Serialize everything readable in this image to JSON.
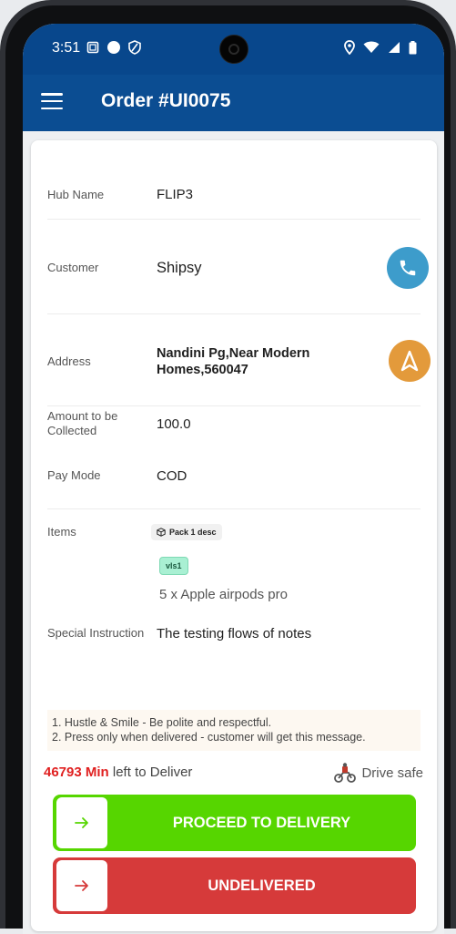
{
  "status_bar": {
    "time": "3:51"
  },
  "app_bar": {
    "title": "Order #UI0075"
  },
  "order": {
    "hub": {
      "label": "Hub Name",
      "value": "FLIP3"
    },
    "customer": {
      "label": "Customer",
      "value": "Shipsy"
    },
    "address": {
      "label": "Address",
      "value_line1": "Nandini Pg,Near Modern",
      "value_line2": "Homes,560047"
    },
    "amount": {
      "label_line1": "Amount to be",
      "label_line2": "Collected",
      "value": "100.0"
    },
    "pay_mode": {
      "label": "Pay Mode",
      "value": "COD"
    },
    "items": {
      "label": "Items",
      "pack_chip": "Pack 1 desc",
      "tag": "vls1",
      "item_text": "5 x Apple airpods pro"
    },
    "special_instruction": {
      "label": "Special Instruction",
      "value": "The testing flows of notes"
    }
  },
  "notes": {
    "line1": "1. Hustle & Smile - Be polite and respectful.",
    "line2": "2. Press only when delivered - customer will get this message."
  },
  "timer": {
    "minutes": "46793 Min",
    "suffix": " left to Deliver",
    "drive_safe": "Drive safe"
  },
  "actions": {
    "proceed_label": "PROCEED TO DELIVERY",
    "undelivered_label": "UNDELIVERED"
  },
  "colors": {
    "primary": "#0b4d92",
    "call_button": "#3d9ccb",
    "navigate_button": "#e39a3b",
    "proceed": "#56d600",
    "undelivered": "#d63a3a",
    "timer_red": "#e02020"
  },
  "icons": {
    "menu": "menu-icon",
    "call": "phone-icon",
    "navigate": "navigation-icon",
    "pack": "box-icon",
    "rider": "rider-icon",
    "arrow": "arrow-right-icon"
  }
}
